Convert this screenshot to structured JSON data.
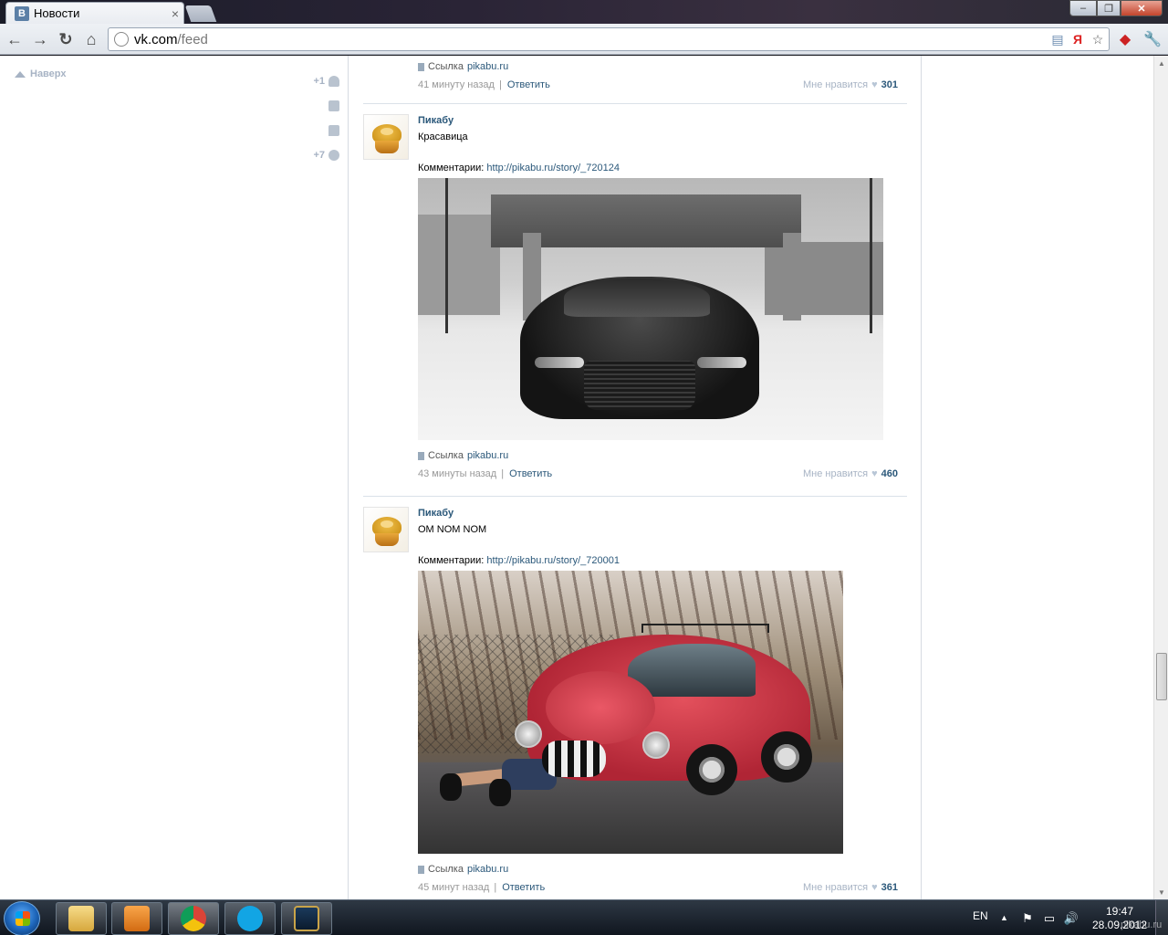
{
  "browser": {
    "tab_title": "Новости",
    "tab_favicon_letter": "В",
    "tab_close": "×",
    "url_host": "vk.com",
    "url_path": "/feed",
    "window_controls": {
      "minimize": "–",
      "maximize": "❐",
      "close": "✕"
    }
  },
  "sidebar": {
    "top_link": "Наверх",
    "counters": [
      {
        "value": "+1",
        "icon": "person-icon"
      },
      {
        "value": "",
        "icon": "mail-icon"
      },
      {
        "value": "",
        "icon": "comment-icon"
      },
      {
        "value": "+7",
        "icon": "gear-icon"
      }
    ]
  },
  "feed": {
    "link_label": "Ссылка",
    "reply_label": "Ответить",
    "like_label": "Мне нравится",
    "first_footer": {
      "link_domain": "pikabu.ru",
      "time": "41 минуту назад",
      "likes": "301"
    },
    "posts": [
      {
        "author": "Пикабу",
        "text": "Красавица",
        "comments_label": "Комментарии:",
        "comments_url": "http://pikabu.ru/story/_720124",
        "link_domain": "pikabu.ru",
        "time": "43 минуты назад",
        "likes": "460"
      },
      {
        "author": "Пикабу",
        "text": "OM NOM NOM",
        "comments_label": "Комментарии:",
        "comments_url": "http://pikabu.ru/story/_720001",
        "link_domain": "pikabu.ru",
        "time": "45 минут назад",
        "likes": "361"
      }
    ]
  },
  "taskbar": {
    "language": "EN",
    "time": "19:47",
    "date": "28.09.2012",
    "watermark": "pikabu.ru"
  }
}
